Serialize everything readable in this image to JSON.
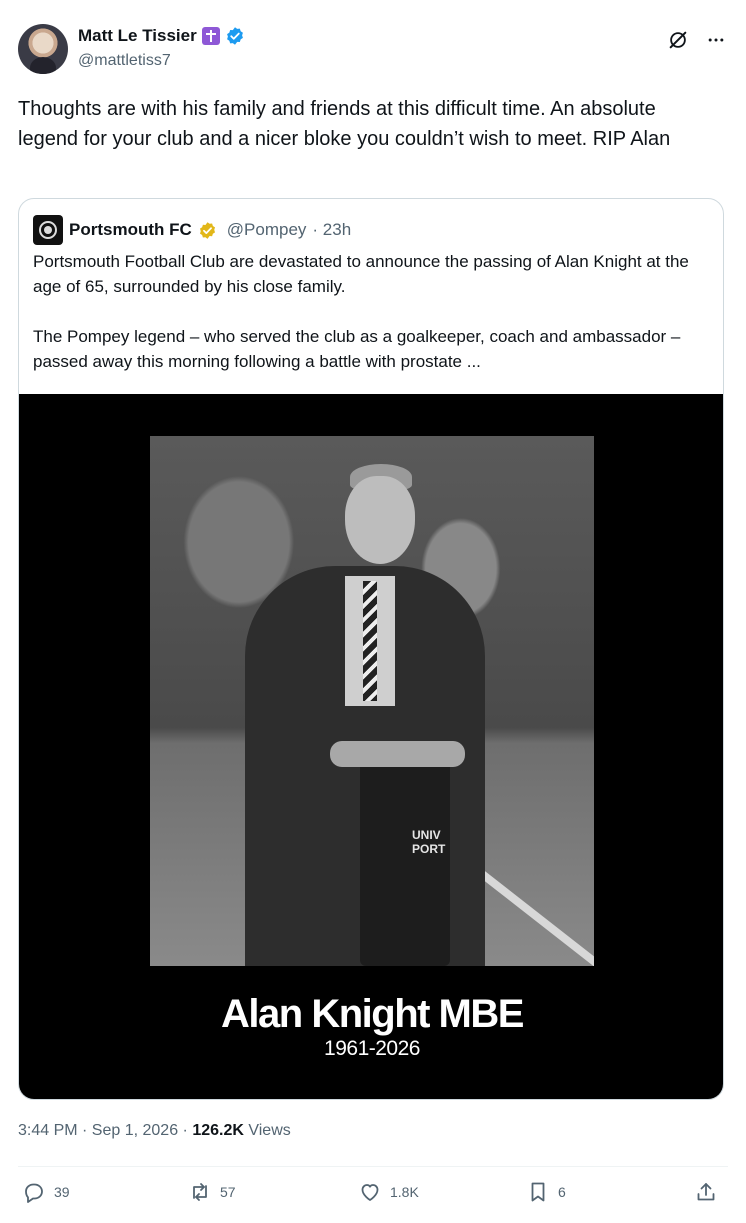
{
  "author": {
    "display_name": "Matt Le Tissier",
    "handle": "@mattletiss7",
    "badges": [
      "cross-badge",
      "verified-badge"
    ]
  },
  "tweet": {
    "text": "Thoughts are with his family and friends at this difficult time. An absolute legend for your club and a nicer bloke you couldn’t wish to meet. RIP Alan"
  },
  "quoted": {
    "name": "Portsmouth FC",
    "handle": "@Pompey",
    "time": "· 23h",
    "paragraph1": "Portsmouth Football Club are devastated to announce the passing of Alan Knight at the age of 65, surrounded by his close family.",
    "paragraph2": "The Pompey legend – who served the club as a goalkeeper, coach and ambassador – passed away this morning following a battle with prostate ...",
    "media": {
      "caption_name": "Alan Knight MBE",
      "caption_years": "1961-2026",
      "jersey_text_line1": "UNIV",
      "jersey_text_line2": "PORT"
    }
  },
  "meta": {
    "timestamp": "3:44 PM · Sep 1, 2026 · ",
    "views_count": "126.2K",
    "views_label": " Views"
  },
  "actions": {
    "replies": "39",
    "reposts": "57",
    "likes": "1.8K",
    "bookmarks": "6"
  },
  "colors": {
    "verified_blue": "#1d9bf0",
    "verified_gold": "#e2b719",
    "cross_purple": "#8e58d6",
    "secondary_text": "#536471"
  }
}
